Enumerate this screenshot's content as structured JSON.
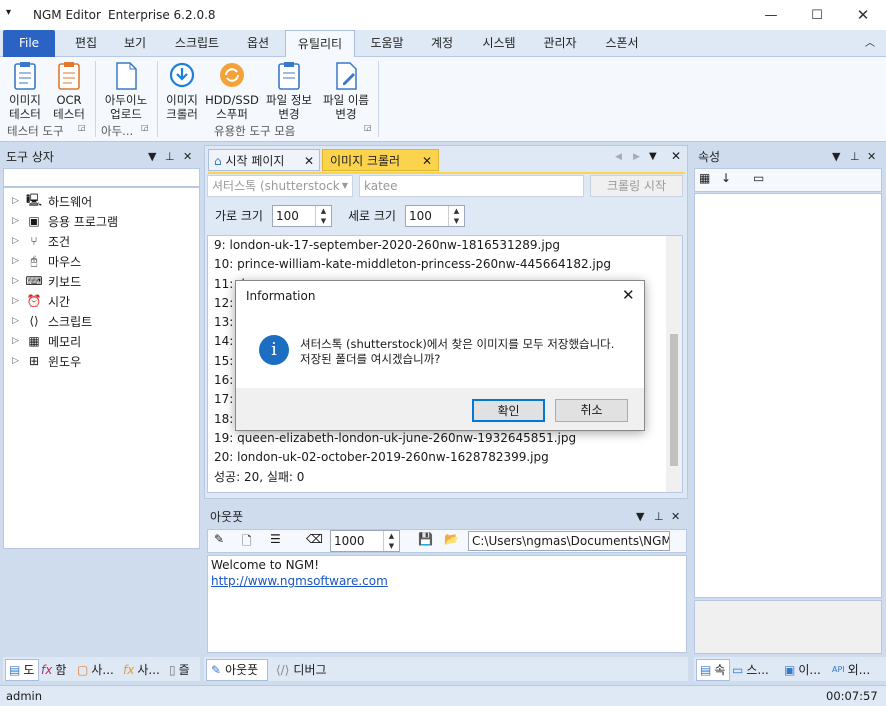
{
  "app": {
    "title": "NGM Editor",
    "edition": "Enterprise 6.2.0.8"
  },
  "menu": [
    "File",
    "편집",
    "보기",
    "스크립트",
    "옵션",
    "유틸리티",
    "도움말",
    "계정",
    "시스템",
    "관리자",
    "스폰서"
  ],
  "ribbon": {
    "b1": "이미지\n테스터",
    "b2": "OCR\n테스터",
    "b3": "아두이노\n업로드",
    "b4": "이미지\n크롤러",
    "b5": "HDD/SSD\n스푸퍼",
    "b6": "파일 정보\n변경",
    "b7": "파일 이름\n변경",
    "g1": "테스터 도구",
    "g2": "아두...",
    "g3": "유용한 도구 모음"
  },
  "toolbox": {
    "title": "도구 상자",
    "items": [
      "하드웨어",
      "응용 프로그램",
      "조건",
      "마우스",
      "키보드",
      "시간",
      "스크립트",
      "메모리",
      "윈도우"
    ]
  },
  "tabs": {
    "start": "시작 페이지",
    "crawler": "이미지 크롤러"
  },
  "crawler": {
    "source": "셔터스톡 (shutterstock",
    "query": "katee",
    "start_btn": "크롤링 시작",
    "width_label": "가로 크기",
    "width": "100",
    "height_label": "세로 크기",
    "height": "100"
  },
  "results": [
    "9: london-uk-17-september-2020-260nw-1816531289.jpg",
    "10: prince-william-kate-middleton-princess-260nw-445664182.jpg",
    "11: d",
    "12: d",
    "13: c",
    "14: p",
    "15: p",
    "16: l",
    "17: l",
    "18: c",
    "19: queen-elizabeth-london-uk-june-260nw-1932645851.jpg",
    "20: london-uk-02-october-2019-260nw-1628782399.jpg",
    "성공: 20, 실패: 0"
  ],
  "output": {
    "title": "아웃풋",
    "count": "1000",
    "path": "C:\\Users\\ngmas\\Documents\\NGM6\\",
    "welcome": "Welcome to NGM!",
    "link": "http://www.ngmsoftware.com"
  },
  "bottom_tabs": {
    "output": "아웃풋",
    "debug": "디버그"
  },
  "left_tabs": [
    "도",
    "함",
    "사...",
    "사...",
    "즐"
  ],
  "props": {
    "title": "속성",
    "tabs": [
      "속",
      "스...",
      "이...",
      "외..."
    ]
  },
  "dialog": {
    "title": "Information",
    "msg1": "셔터스톡 (shutterstock)에서 찾은 이미지를 모두 저장했습니다.",
    "msg2": "저장된 폴더를 여시겠습니까?",
    "ok": "확인",
    "cancel": "취소"
  },
  "status": {
    "user": "admin",
    "time": "00:07:57"
  }
}
